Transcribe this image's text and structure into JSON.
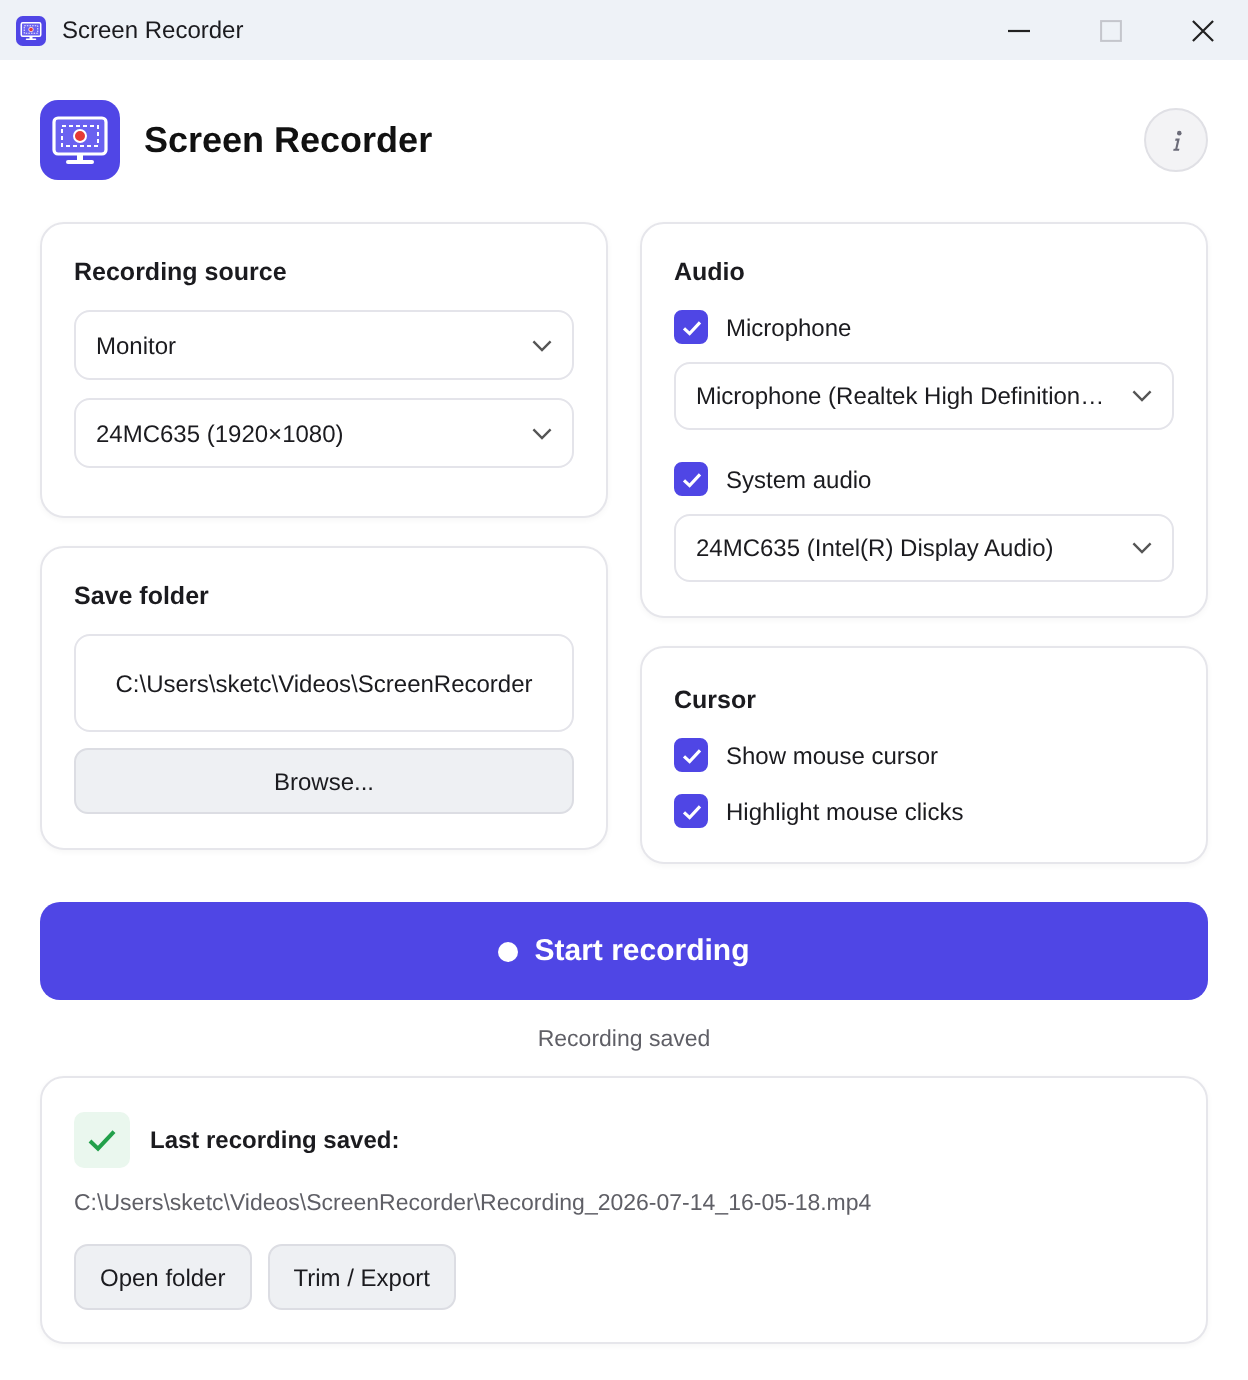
{
  "window": {
    "title": "Screen Recorder",
    "controls": [
      {
        "kind": "minimize",
        "disabled": false
      },
      {
        "kind": "maximize",
        "disabled": true
      },
      {
        "kind": "close",
        "disabled": false
      }
    ]
  },
  "header": {
    "title": "Screen Recorder"
  },
  "recording_source": {
    "title": "Recording source",
    "selects": [
      {
        "value": "Monitor"
      },
      {
        "value": "24MC635 (1920×1080)"
      }
    ]
  },
  "save_folder": {
    "title": "Save folder",
    "path": "C:\\Users\\sketc\\Videos\\ScreenRecorder",
    "button": "Browse..."
  },
  "audio": {
    "title": "Audio",
    "items": [
      {
        "kind": "checkbox",
        "label": "Microphone",
        "checked": true
      },
      {
        "kind": "select",
        "value": "Microphone (Realtek High Definition…"
      },
      {
        "kind": "checkbox",
        "label": "System audio",
        "checked": true
      },
      {
        "kind": "select",
        "value": "24MC635 (Intel(R) Display Audio)"
      }
    ]
  },
  "cursor": {
    "title": "Cursor",
    "options": [
      {
        "label": "Show mouse cursor",
        "checked": true
      },
      {
        "label": "Highlight mouse clicks",
        "checked": true
      }
    ]
  },
  "record_button": {
    "label": "Start recording"
  },
  "status": "Recording saved",
  "last_recording": {
    "title": "Last recording saved:",
    "path": "C:\\Users\\sketc\\Videos\\ScreenRecorder\\Recording_2026-07-14_16-05-18.mp4",
    "buttons": [
      "Open folder",
      "Trim / Export"
    ]
  }
}
